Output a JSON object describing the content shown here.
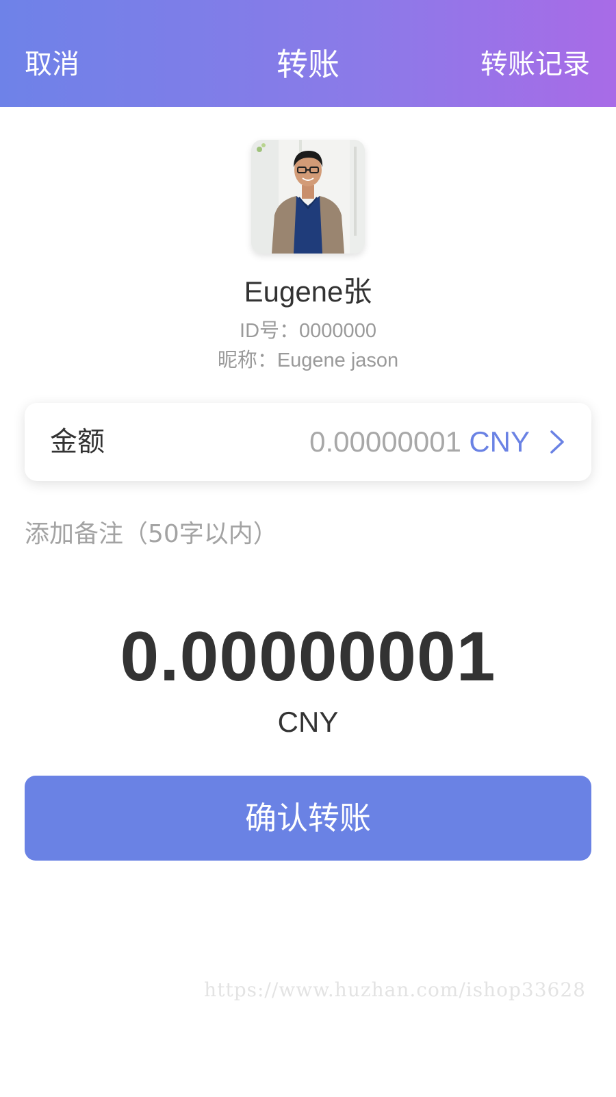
{
  "header": {
    "cancel_label": "取消",
    "title": "转账",
    "history_label": "转账记录",
    "gradient_colors": [
      "#6e82e8",
      "#a86be7"
    ]
  },
  "profile": {
    "avatar": "person-photo",
    "name": "Eugene张",
    "id_text": "ID号：0000000",
    "nickname_text": "昵称：Eugene jason"
  },
  "amount_card": {
    "label": "金额",
    "value": "0.00000001",
    "currency": "CNY",
    "chevron_icon": "chevron-right-icon",
    "accent_color": "#6a82e4"
  },
  "remark": {
    "placeholder": "添加备注（50字以内）"
  },
  "summary": {
    "amount": "0.00000001",
    "currency": "CNY"
  },
  "confirm": {
    "label": "确认转账",
    "color": "#6a82e4"
  },
  "watermark": {
    "text": "https://www.huzhan.com/ishop33628"
  }
}
